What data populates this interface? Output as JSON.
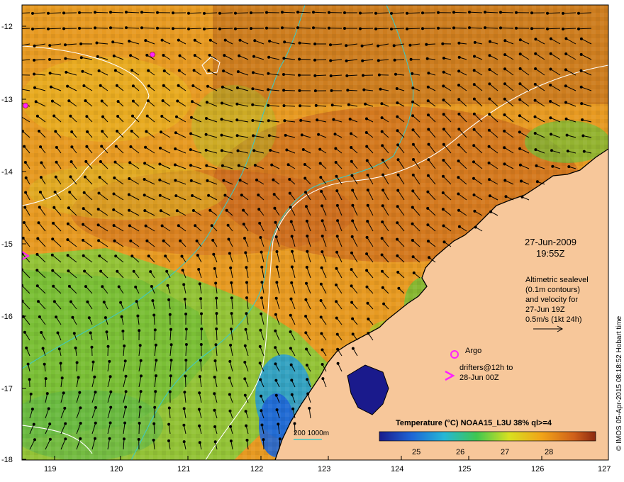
{
  "map": {
    "lon_ticks": [
      "119",
      "120",
      "121",
      "122",
      "123",
      "124",
      "125",
      "126",
      "127"
    ],
    "lat_ticks": [
      "-12",
      "-13",
      "-14",
      "-15",
      "-16",
      "-17",
      "-18"
    ],
    "date": "27-Jun-2009",
    "time": "19:55Z",
    "info_lines": [
      "Altimetric sealevel",
      "(0.1m contours)",
      "and velocity for",
      "27-Jun 19Z",
      "0.5m/s (1kt 24h)"
    ],
    "argo_label": "Argo",
    "drifters_lines": [
      "drifters@12h to",
      "28-Jun 00Z"
    ],
    "depth_label": "200  1000m",
    "colorbar_title": "Temperature (°C) NOAA15_L3U 38% ql>=4",
    "colorbar_ticks": [
      "25",
      "26",
      "27",
      "28"
    ],
    "credit": "© IMOS 05-Apr-2015 08:18:52 Hobart time",
    "colors": {
      "land": "#f7c79a",
      "sst_warm": "#c8641e",
      "sst_mid": "#e79a22",
      "sst_cool": "#8ac83a",
      "sst_cold": "#1f8ad0",
      "contour": "#ffffff",
      "depth_contour": "#3fc9c1",
      "argo": "#ff22ff",
      "drifter": "#ff22ff",
      "vector": "#000000"
    }
  }
}
